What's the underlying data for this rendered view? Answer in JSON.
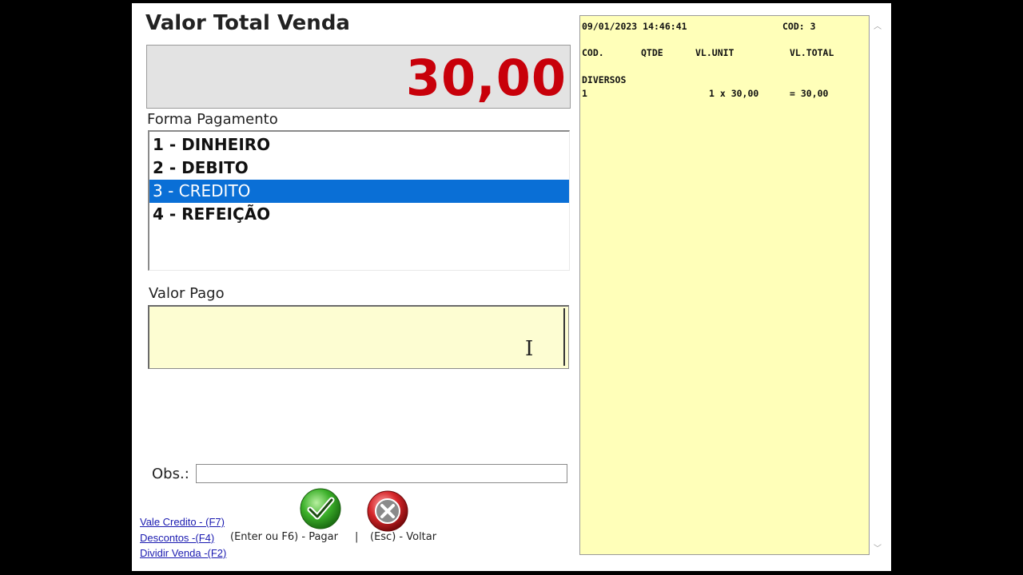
{
  "form": {
    "title": "Valor Total Venda",
    "total_value": "30,00",
    "payment_label": "Forma Pagamento",
    "payment_methods": [
      {
        "label": "1 - DINHEIRO",
        "selected": false
      },
      {
        "label": "2 - DEBITO",
        "selected": false
      },
      {
        "label": "3 - CREDITO",
        "selected": true
      },
      {
        "label": "4 - REFEIÇÃO",
        "selected": false
      }
    ],
    "paid_label": "Valor Pago",
    "paid_value": "",
    "obs_label": "Obs.:",
    "obs_value": ""
  },
  "shortcuts": {
    "vale_credito": "Vale Credito - (F7)",
    "descontos": "Descontos -(F4)",
    "dividir_venda": "Dividir Venda -(F2)"
  },
  "actions": {
    "pay_label": "(Enter ou F6) - Pagar",
    "separator": "|",
    "back_label": "(Esc) - Voltar"
  },
  "receipt": {
    "datetime": "09/01/2023 14:46:41",
    "cod": "COD: 3",
    "headers": {
      "cod": "COD.",
      "qtde": "QTDE",
      "vl_unit": "VL.UNIT",
      "vl_total": "VL.TOTAL"
    },
    "item_name": "DIVERSOS",
    "item_code": "1",
    "item_qty_unit": "1 x 30,00",
    "item_total": "= 30,00"
  },
  "colors": {
    "total_red": "#c8000a",
    "selection_blue": "#0a6fd6",
    "receipt_bg": "#ffffb9",
    "input_bg": "#fdfdd2"
  }
}
